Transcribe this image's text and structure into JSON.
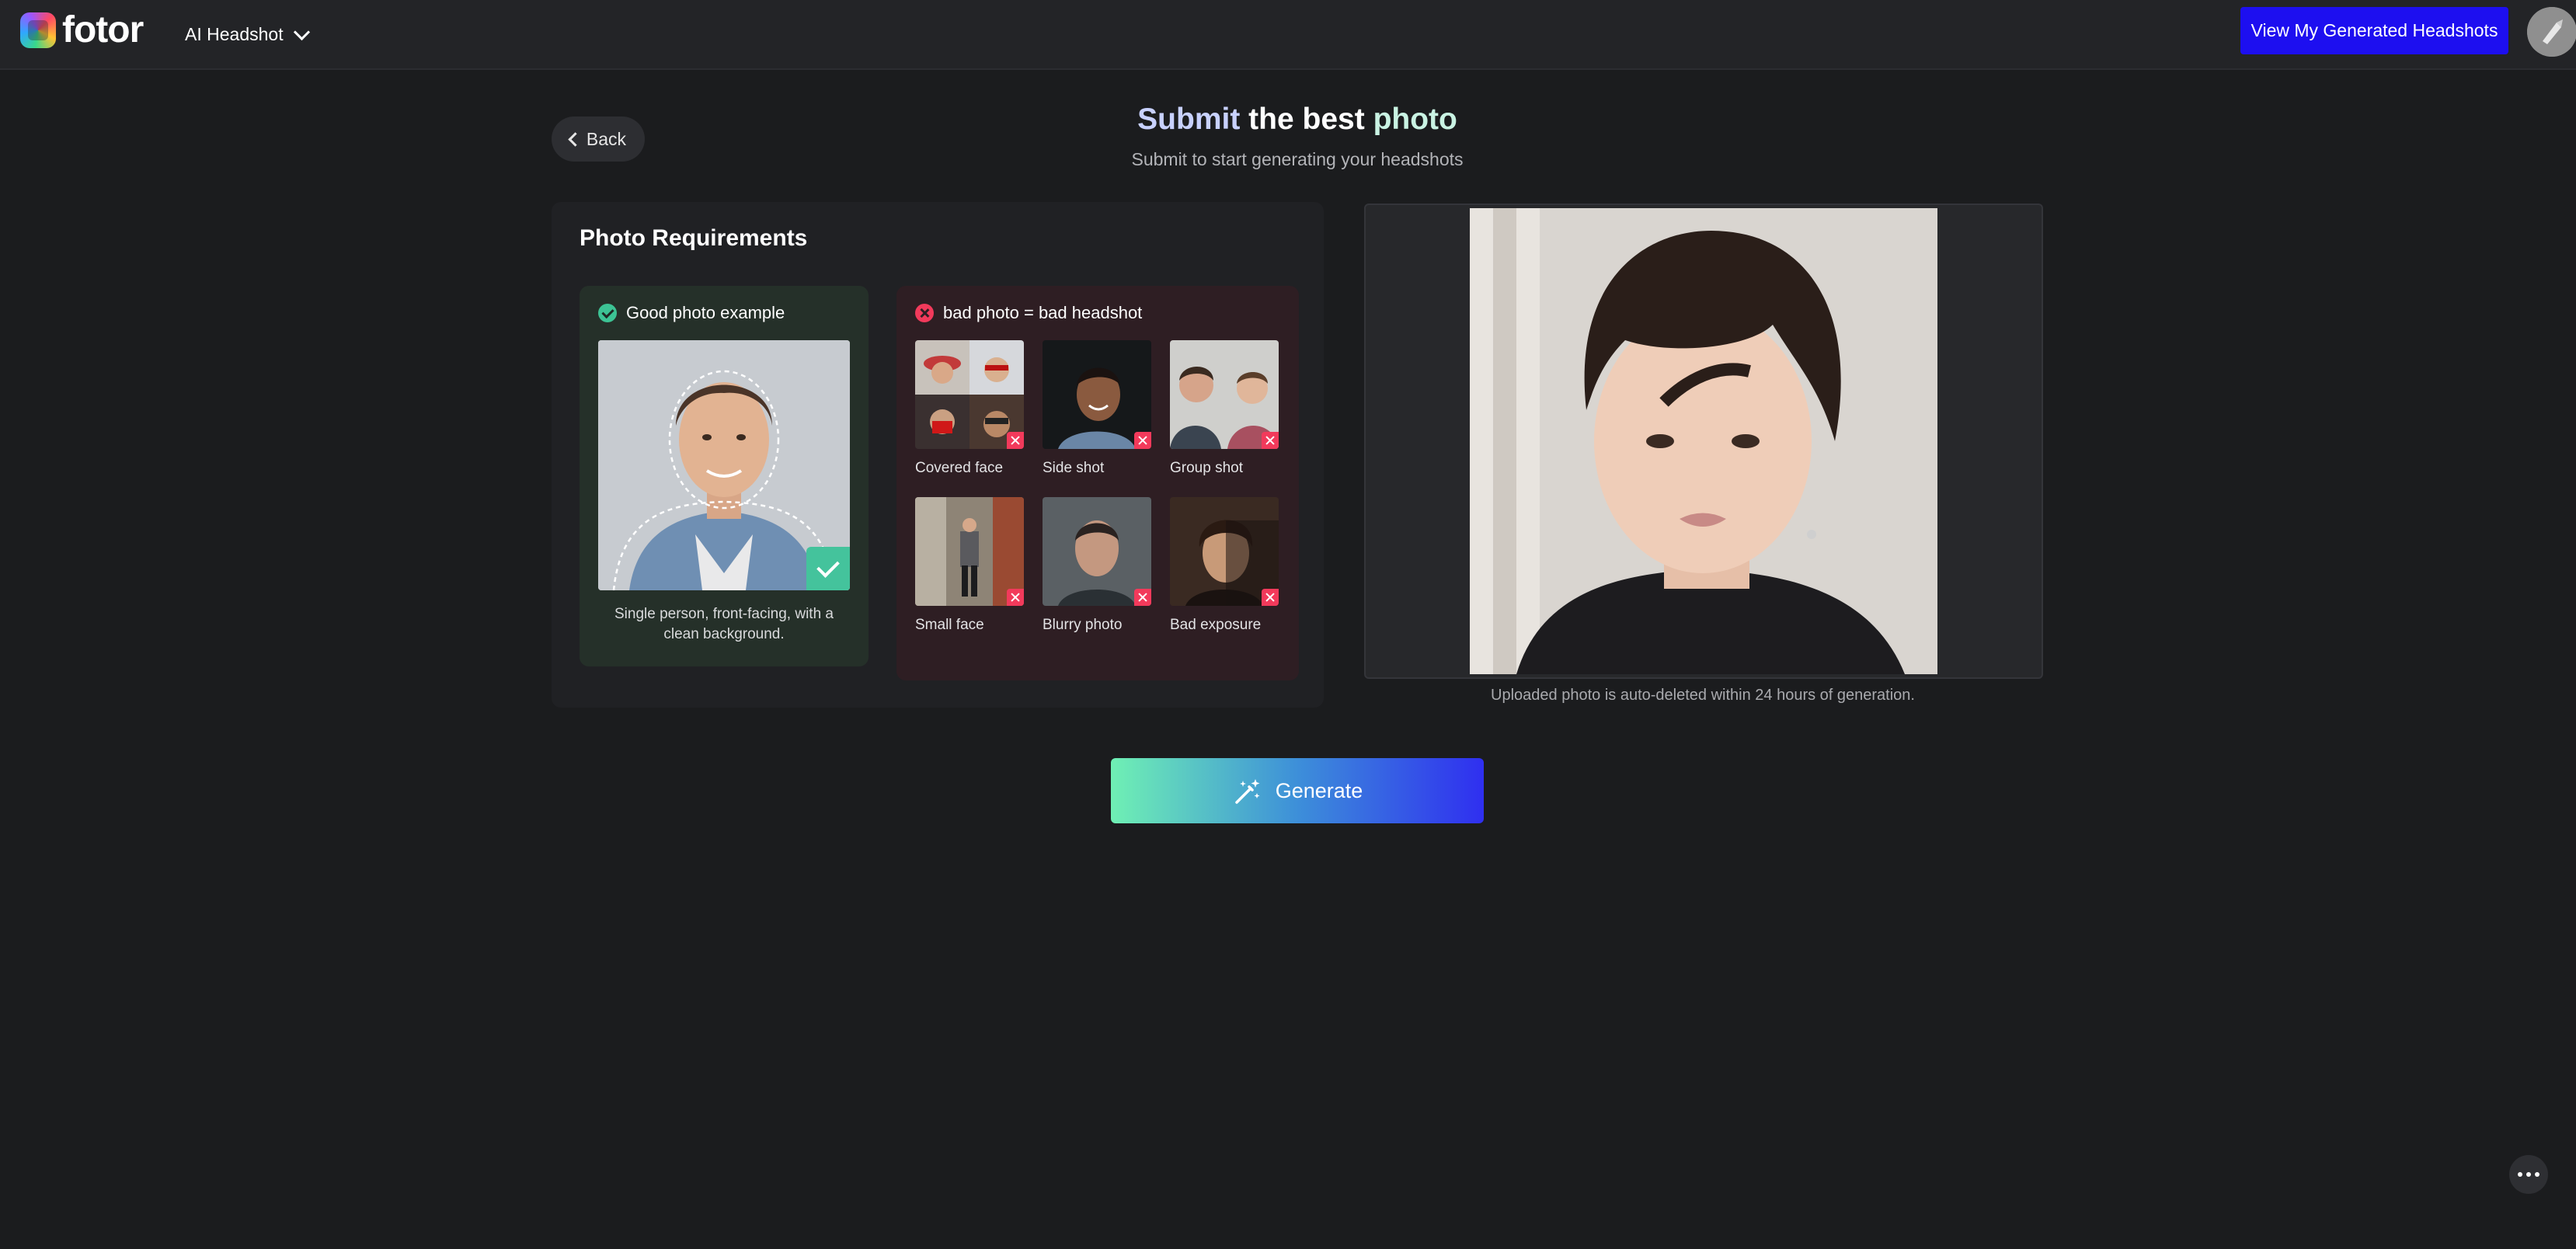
{
  "header": {
    "logo_text": "fotor",
    "product_menu_label": "AI Headshot",
    "view_button_label": "View My Generated Headshots",
    "accent_color": "#1d0ff0"
  },
  "page": {
    "back_label": "Back",
    "title_words": [
      "Submit",
      "the",
      "best",
      "photo"
    ],
    "subtitle": "Submit to start generating your headshots"
  },
  "requirements": {
    "title": "Photo Requirements",
    "good": {
      "heading": "Good photo example",
      "caption": "Single person, front-facing, with a clean background."
    },
    "bad": {
      "heading": "bad photo = bad headshot",
      "items": [
        {
          "label": "Covered face"
        },
        {
          "label": "Side shot"
        },
        {
          "label": "Group shot"
        },
        {
          "label": "Small face"
        },
        {
          "label": "Blurry photo"
        },
        {
          "label": "Bad exposure"
        }
      ]
    }
  },
  "upload": {
    "note": "Uploaded photo is auto-deleted within 24 hours of generation."
  },
  "actions": {
    "generate_label": "Generate"
  },
  "colors": {
    "good_badge": "#3cc394",
    "bad_badge": "#f23a5b"
  }
}
